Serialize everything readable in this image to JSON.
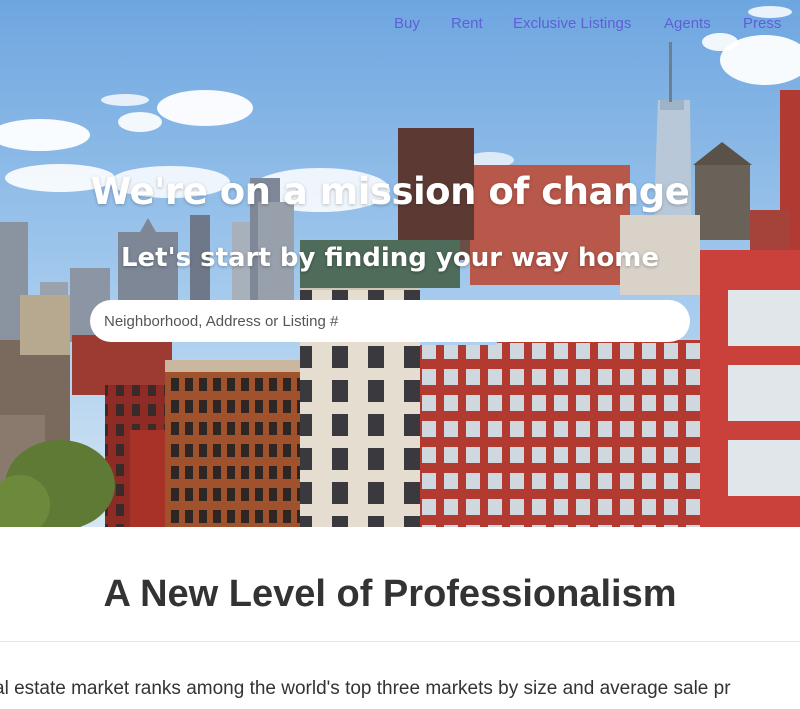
{
  "nav": {
    "items": [
      {
        "label": "Buy"
      },
      {
        "label": "Rent"
      },
      {
        "label": "Exclusive Listings"
      },
      {
        "label": "Agents"
      },
      {
        "label": "Press"
      }
    ]
  },
  "hero": {
    "title": "We're on a mission of change",
    "subtitle": "Let's start by finding your way home",
    "search_placeholder": "Neighborhood, Address or Listing #"
  },
  "section": {
    "title": "A New Level of Professionalism",
    "body": "al estate market ranks among the world's top three markets by size and average sale pr"
  },
  "colors": {
    "nav_link": "#5f5fd6",
    "sky": "#7fb3e6",
    "brick": "#a9362d",
    "heading_text": "#333333"
  }
}
